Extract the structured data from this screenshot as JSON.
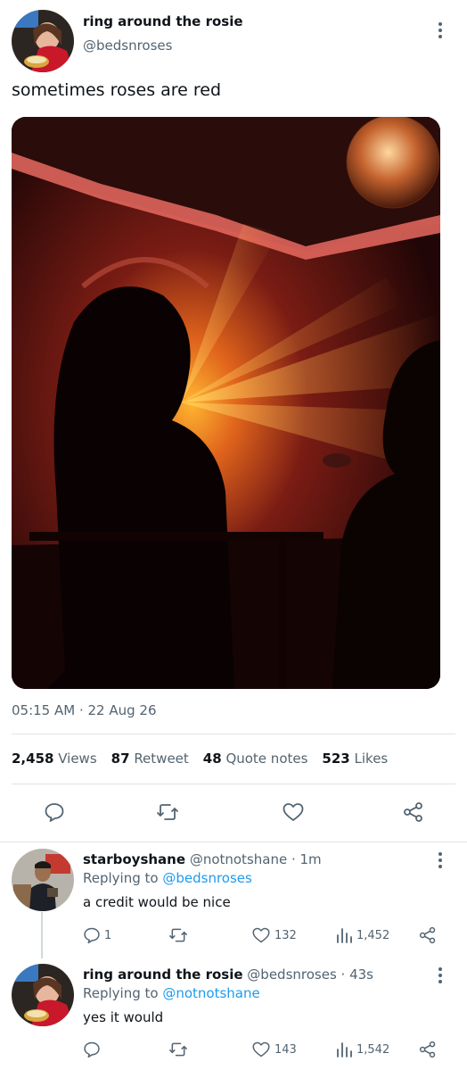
{
  "tweet": {
    "author_name": "ring around the rosie",
    "author_handle": "@bedsnroses",
    "text": "sometimes roses are red",
    "timestamp": "05:15 AM · 22 Aug 26",
    "stats": {
      "views_count": "2,458",
      "views_label": "Views",
      "retweet_count": "87",
      "retweet_label": "Retweet",
      "quote_count": "48",
      "quote_label": "Quote notes",
      "likes_count": "523",
      "likes_label": "Likes"
    },
    "icons": [
      "reply-icon",
      "retweet-icon",
      "like-icon",
      "share-icon",
      "more-icon"
    ]
  },
  "replies": [
    {
      "name": "starboyshane",
      "handle_time": "@notnotshane · 1m",
      "replying_prefix": "Replying to",
      "replying_to": "@bedsnroses",
      "text": "a credit would be nice",
      "reply_count": "1",
      "like_count": "132",
      "view_count": "1,452"
    },
    {
      "name": "ring around the rosie",
      "handle_time": "@bedsnroses · 43s",
      "replying_prefix": "Replying to",
      "replying_to": "@notnotshane",
      "text": "yes it would",
      "reply_count": "",
      "like_count": "143",
      "view_count": "1,542"
    }
  ],
  "colors": {
    "text": "#0f1419",
    "secondary": "#536471",
    "link": "#1d9bf0",
    "divider": "#dfe3e6"
  }
}
